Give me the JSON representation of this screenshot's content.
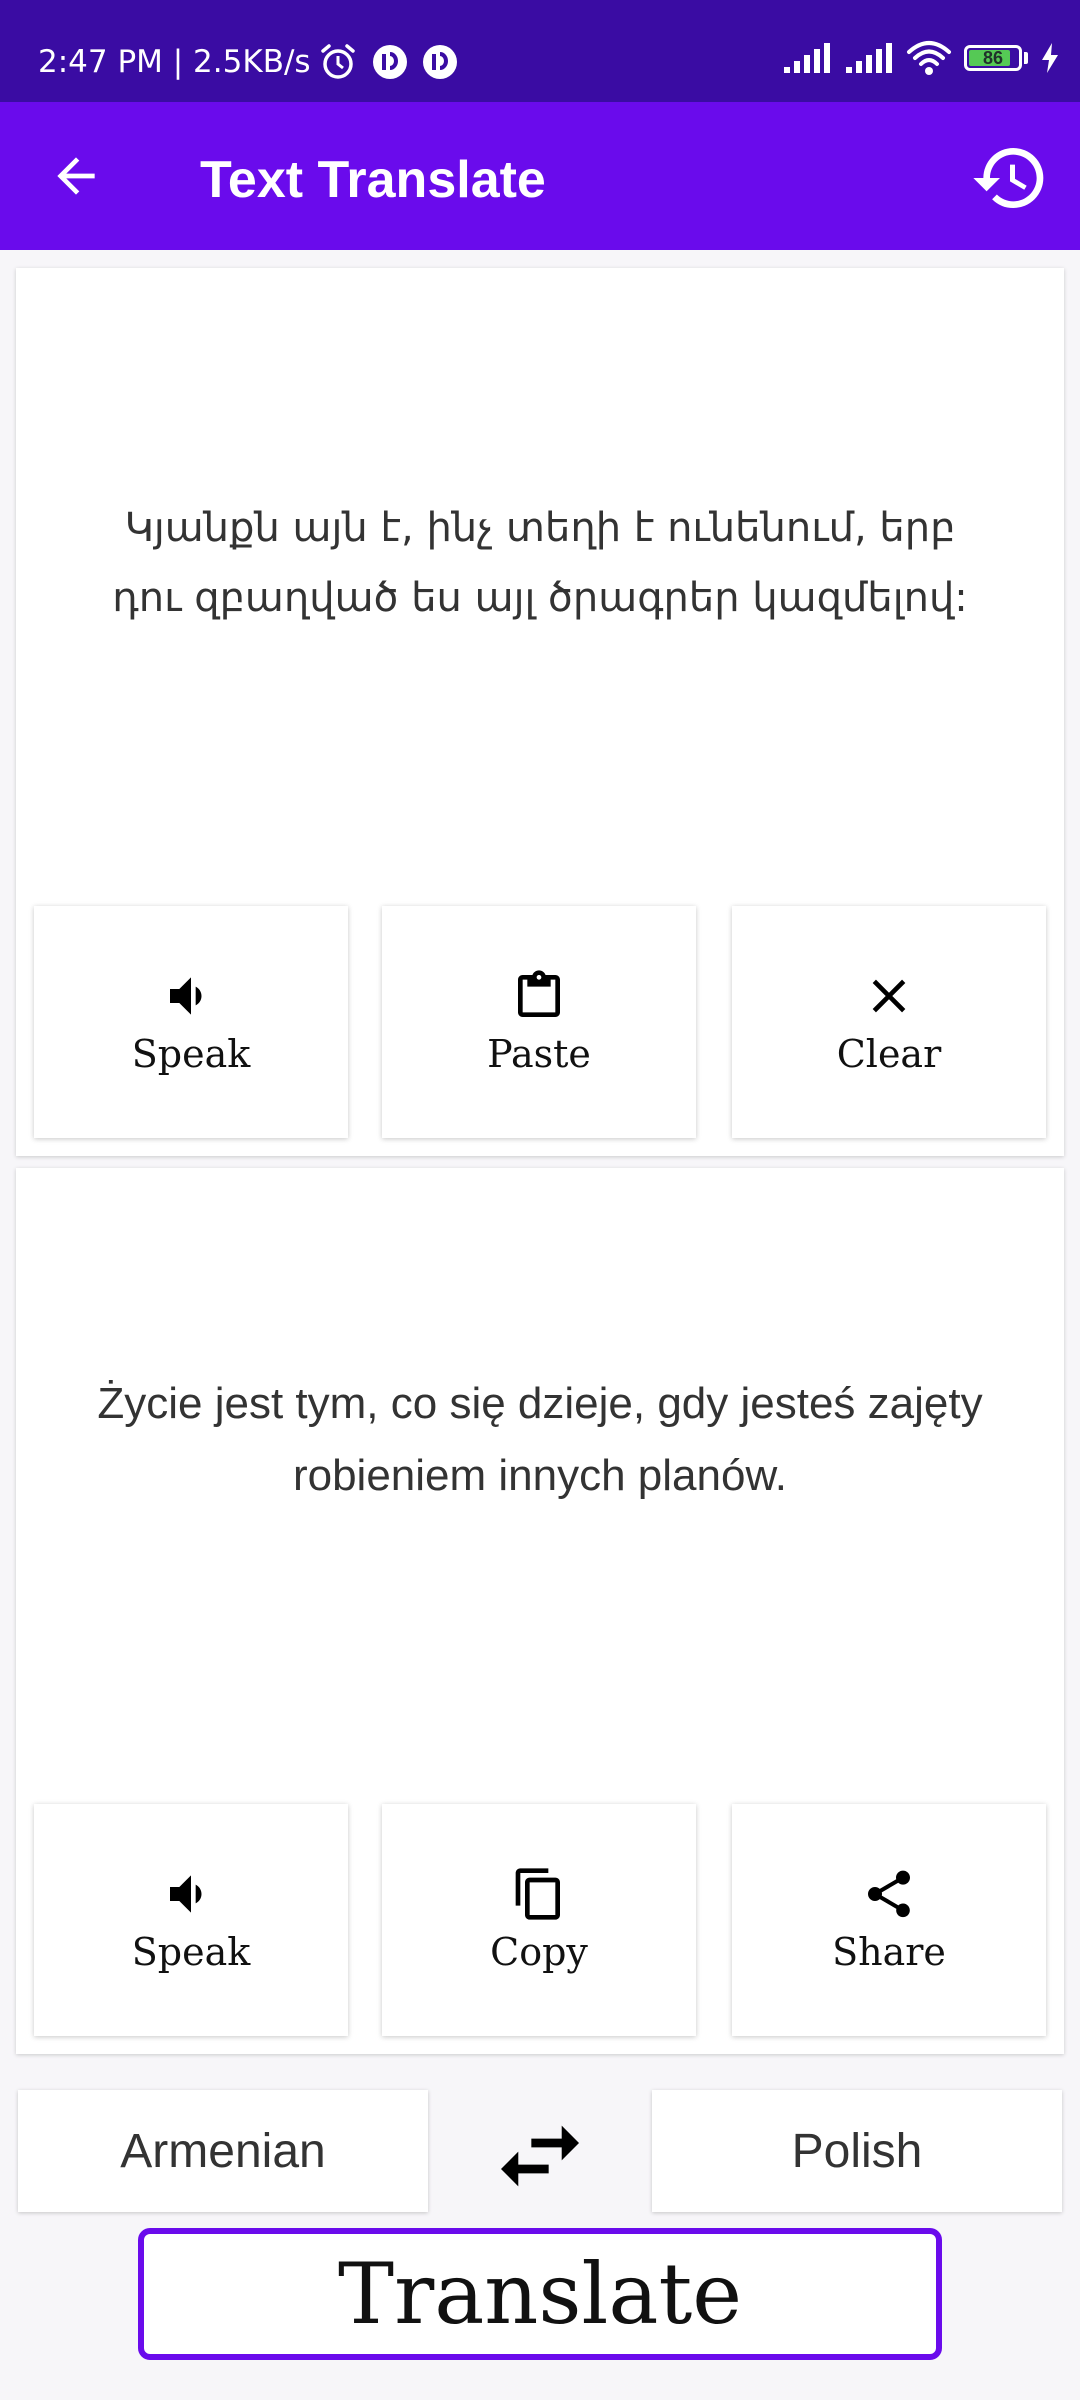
{
  "status_bar": {
    "time": "2:47 PM | 2.5KB/s",
    "battery_level": "86",
    "battery_fraction": 0.86,
    "icons": [
      "alarm-icon",
      "app-notification-icon",
      "app-notification-icon",
      "signal-icon",
      "signal-icon",
      "wifi-icon",
      "battery-icon",
      "charging-icon"
    ]
  },
  "app_bar": {
    "title": "Text Translate",
    "back_icon": "arrow-back-icon",
    "history_icon": "history-icon",
    "background": "#6a0bec"
  },
  "source": {
    "text": "Կյանքն այն է, ինչ տեղի է ունենում, երբ դու զբաղված ես այլ ծրագրեր կազմելով:",
    "actions": [
      {
        "label": "Speak",
        "icon": "speaker-icon"
      },
      {
        "label": "Paste",
        "icon": "clipboard-icon"
      },
      {
        "label": "Clear",
        "icon": "close-icon"
      }
    ]
  },
  "target": {
    "text": "Życie jest tym, co się dzieje, gdy jesteś zajęty robieniem innych planów.",
    "actions": [
      {
        "label": "Speak",
        "icon": "speaker-icon"
      },
      {
        "label": "Copy",
        "icon": "copy-icon"
      },
      {
        "label": "Share",
        "icon": "share-icon"
      }
    ]
  },
  "languages": {
    "from": "Armenian",
    "to": "Polish",
    "swap_icon": "swap-icon"
  },
  "translate_button": {
    "label": "Translate",
    "border_color": "#6a0bec"
  }
}
